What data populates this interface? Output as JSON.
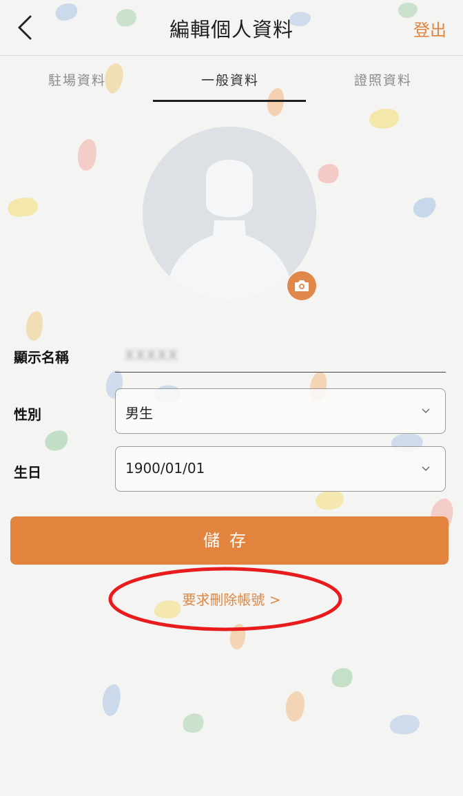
{
  "header": {
    "title": "編輯個人資料",
    "logout_label": "登出"
  },
  "tabs": [
    {
      "label": "駐場資料",
      "active": false
    },
    {
      "label": "一般資料",
      "active": true
    },
    {
      "label": "證照資料",
      "active": false
    }
  ],
  "form": {
    "display_name": {
      "label": "顯示名稱",
      "value": "XXXXX"
    },
    "gender": {
      "label": "性別",
      "value": "男生"
    },
    "birthday": {
      "label": "生日",
      "value": "1900/01/01"
    }
  },
  "save_label": "儲存",
  "delete_account_label": "要求刪除帳號 >",
  "colors": {
    "accent": "#e2843e",
    "annotation": "#e81c1c",
    "background": "#f4f4f2"
  },
  "icons": [
    "back-arrow-icon",
    "camera-icon",
    "chevron-down-icon",
    "avatar-placeholder-icon"
  ]
}
